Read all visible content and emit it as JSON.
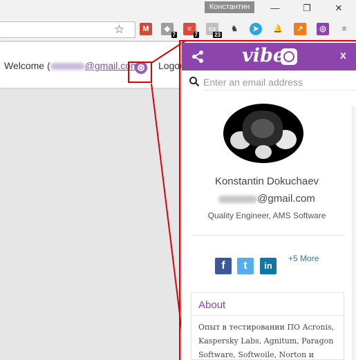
{
  "window": {
    "profile_name": "Константин",
    "minimize": "—",
    "restore": "❐",
    "close": "✕"
  },
  "toolbar": {
    "bookmark_icon": "star-icon",
    "extensions": [
      {
        "name": "gmail",
        "label": "M",
        "color": "#d14836",
        "badge": ""
      },
      {
        "name": "tag",
        "label": "◆",
        "color": "#9e9e9e",
        "badge": "7"
      },
      {
        "name": "todoist",
        "label": "≡",
        "color": "#db4c3f",
        "badge": "7"
      },
      {
        "name": "pages",
        "label": "▭",
        "color": "#c0c0c0",
        "badge": "23"
      },
      {
        "name": "evernote",
        "label": "♞",
        "color": "#444444",
        "badge": ""
      },
      {
        "name": "telegram",
        "label": "➤",
        "color": "#2ca5e0",
        "badge": ""
      },
      {
        "name": "bell",
        "label": "🔔",
        "color": "#9e9e9e",
        "badge": ""
      },
      {
        "name": "chart",
        "label": "↗",
        "color": "#f07d17",
        "badge": ""
      },
      {
        "name": "vibe",
        "label": "◎",
        "color": "#8e44ad",
        "badge": ""
      },
      {
        "name": "menu",
        "label": "≡",
        "color": "#555555",
        "badge": ""
      }
    ]
  },
  "page": {
    "welcome_prefix": "Welcome (",
    "welcome_email": "@gmail.com",
    "welcome_suffix": ")",
    "logout": "Logou"
  },
  "panel": {
    "logo": "vibe",
    "close_label": "x",
    "search_placeholder": "Enter an email address",
    "profile": {
      "name": "Konstantin Dokuchaev",
      "email_domain": "@gmail.com",
      "title": "Quality Engineer, AMS Software"
    },
    "social": [
      {
        "name": "facebook",
        "label": "f",
        "color": "#3b5998"
      },
      {
        "name": "twitter",
        "label": "t",
        "color": "#55acee"
      },
      {
        "name": "linkedin",
        "label": "in",
        "color": "#0e76a8"
      }
    ],
    "more_label": "+5 More",
    "about": {
      "title": "About",
      "text": "Опыт в тестировании ПО Acronis, Kaspersky Labs, Agnitum, Paragon Software, Softwoile, Norton и многих"
    }
  },
  "colors": {
    "accent": "#8e44ad",
    "highlight": "#dd0000"
  }
}
